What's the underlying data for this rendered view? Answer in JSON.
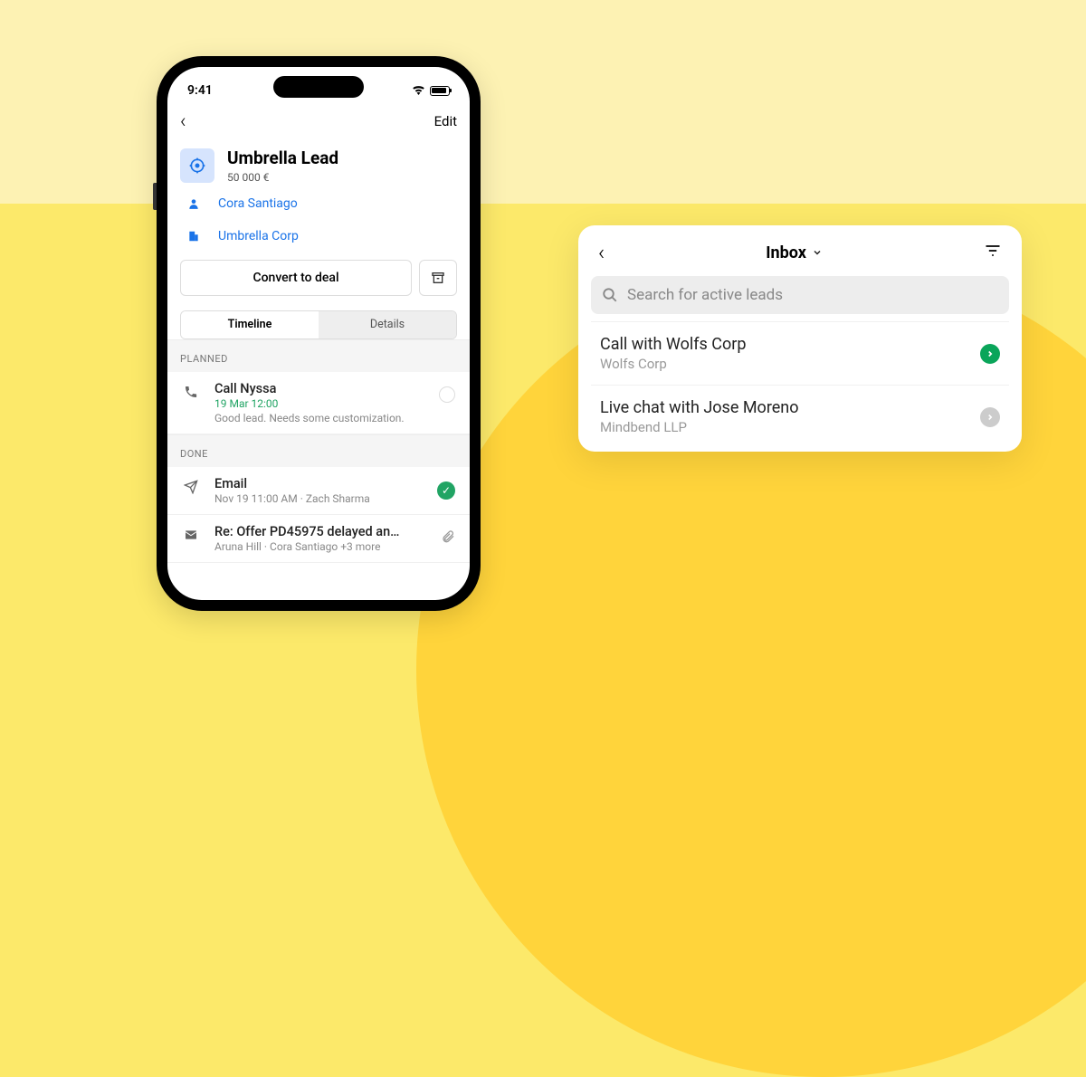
{
  "phone": {
    "status_time": "9:41",
    "nav": {
      "edit": "Edit"
    },
    "header": {
      "title": "Umbrella Lead",
      "amount": "50 000 €"
    },
    "links": {
      "person": "Cora Santiago",
      "org": "Umbrella Corp"
    },
    "buttons": {
      "convert": "Convert to deal"
    },
    "tabs": {
      "timeline": "Timeline",
      "details": "Details"
    },
    "sections": {
      "planned": "PLANNED",
      "done": "DONE"
    },
    "planned_item": {
      "title": "Call Nyssa",
      "time": "19 Mar 12:00",
      "note": "Good lead. Needs some customization."
    },
    "done_email": {
      "title": "Email",
      "meta": "Nov 19 11:00 AM · Zach Sharma"
    },
    "done_thread": {
      "title": "Re: Offer PD45975 delayed an…",
      "meta": "Aruna Hill · Cora Santiago +3 more"
    }
  },
  "card": {
    "title": "Inbox",
    "search_placeholder": "Search for active leads",
    "items": [
      {
        "title": "Call with Wolfs Corp",
        "sub": "Wolfs Corp",
        "status": "green"
      },
      {
        "title": "Live chat with Jose Moreno",
        "sub": "Mindbend LLP",
        "status": "gray"
      }
    ]
  }
}
